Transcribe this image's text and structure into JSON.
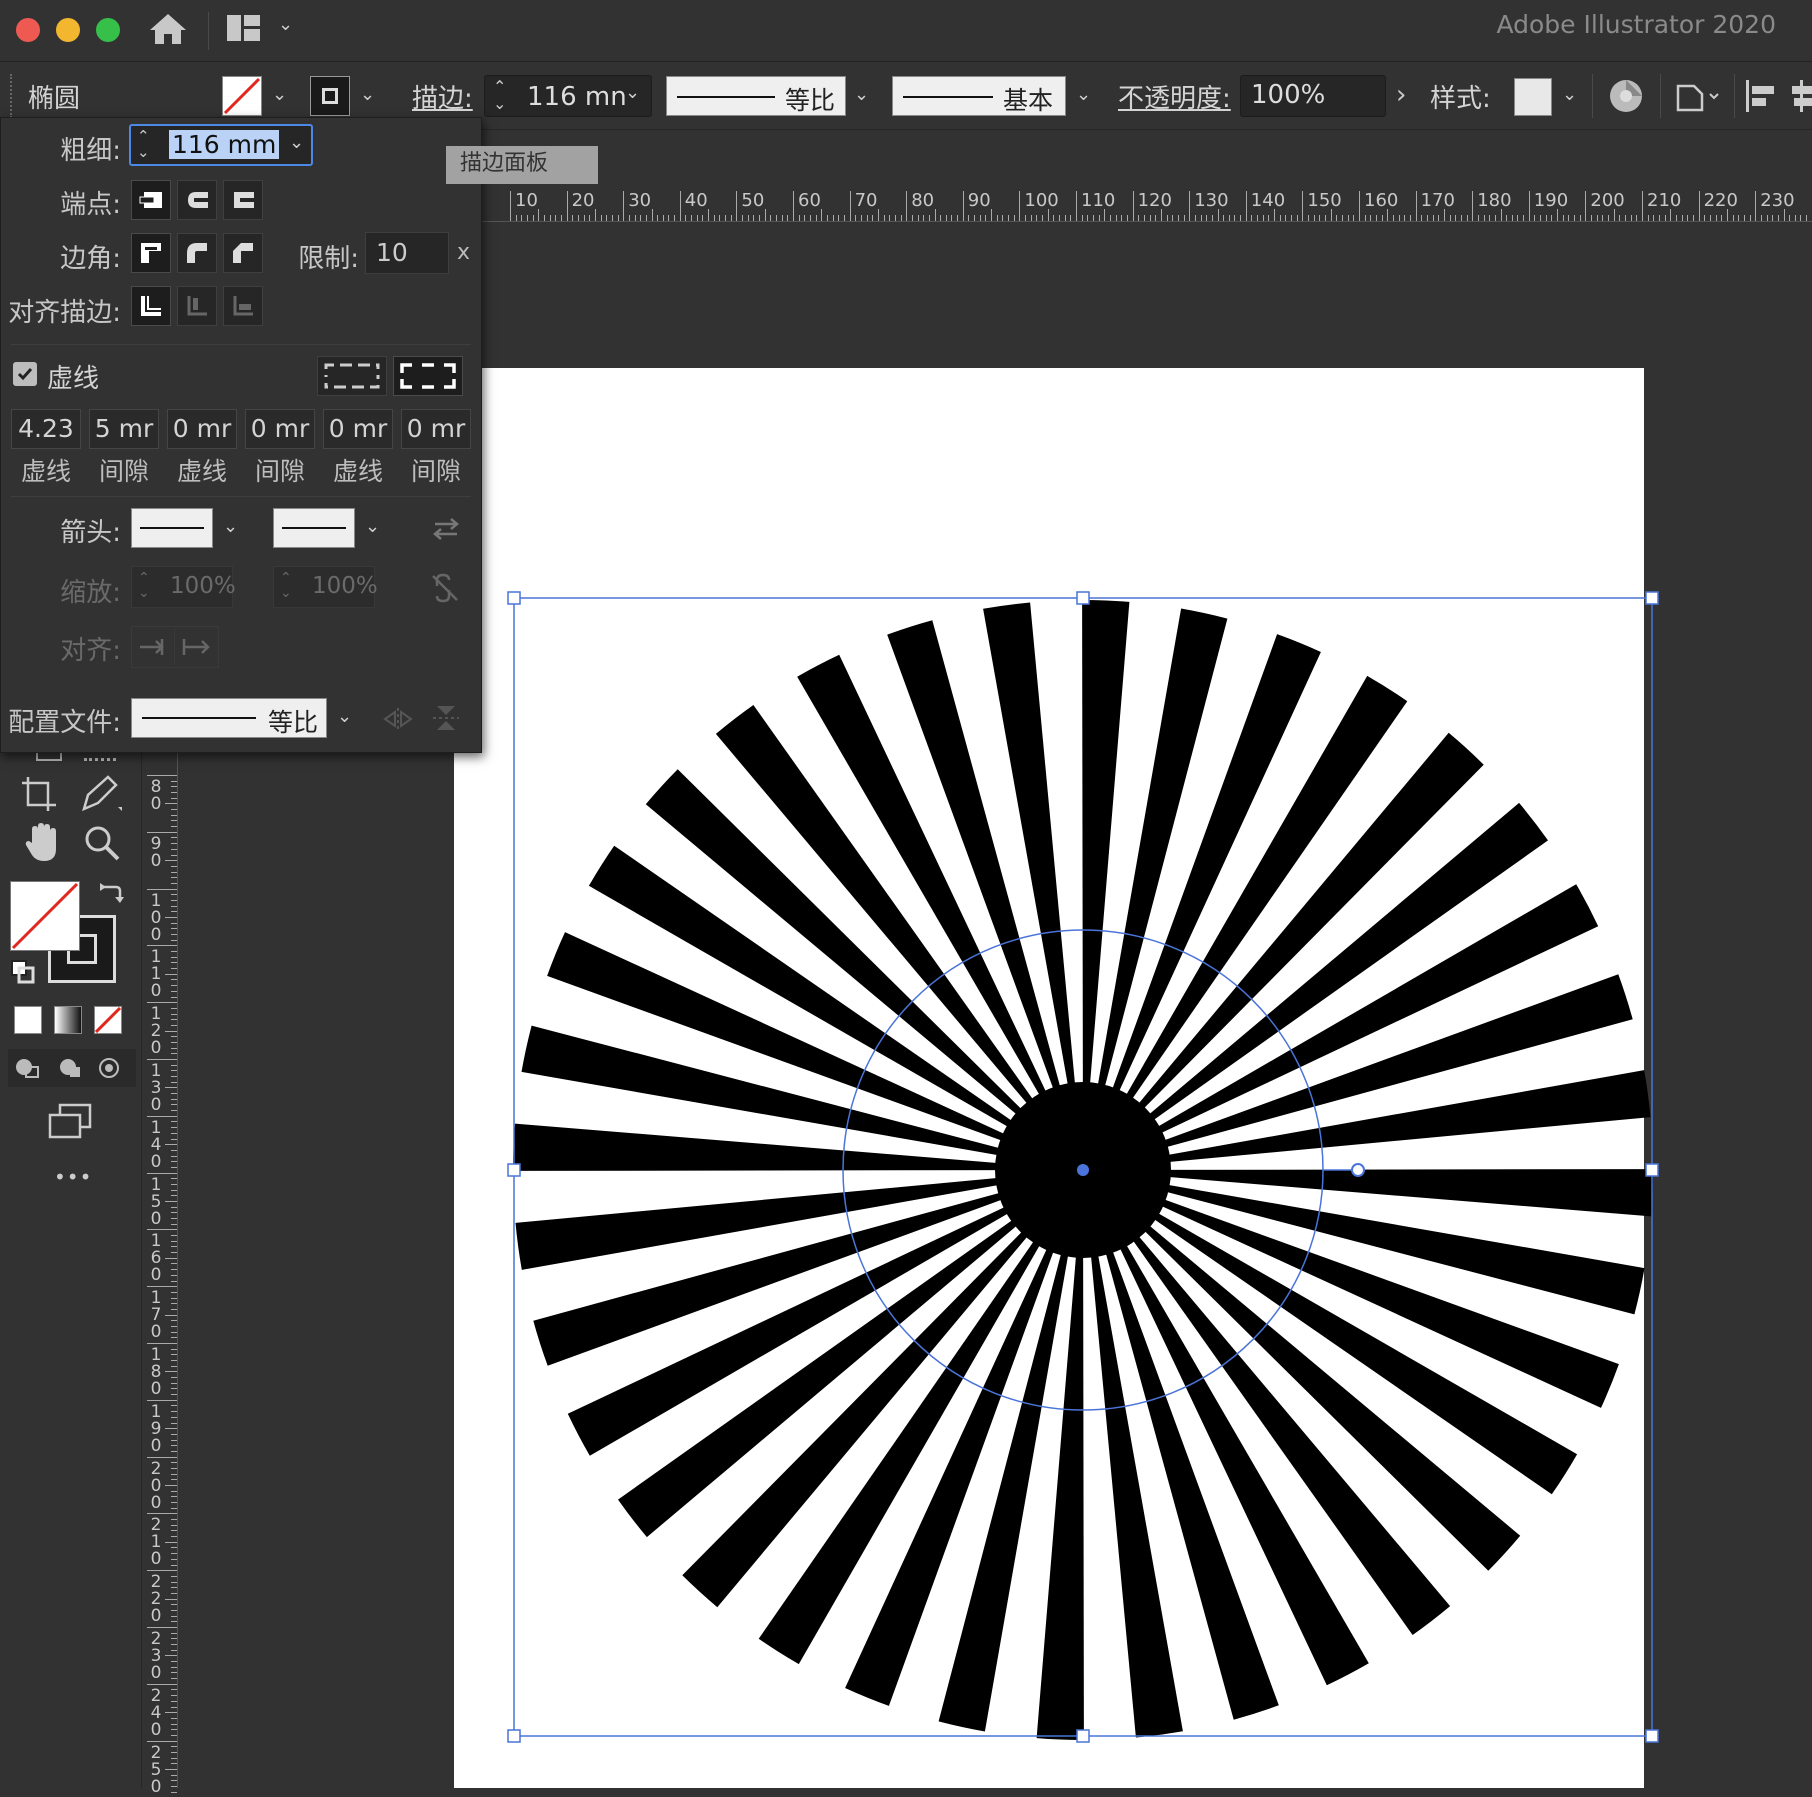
{
  "titlebar": {
    "app_title": "Adobe Illustrator 2020",
    "icons": [
      "close-dot",
      "minimize-dot",
      "zoom-dot",
      "home-icon",
      "workspace-layout-icon",
      "chevron-down-icon"
    ]
  },
  "control_bar": {
    "object_type": "椭圆",
    "stroke_label": "描边:",
    "stroke_weight": "116 mm",
    "stroke_weight_visible": "116 mn",
    "profile1_label": "等比",
    "profile2_label": "基本",
    "opacity_label": "不透明度:",
    "opacity_value": "100%",
    "style_label": "样式:"
  },
  "tooltip": {
    "text": "描边面板"
  },
  "stroke_panel": {
    "weight_label": "粗细:",
    "weight_value": "116 mm",
    "cap_label": "端点:",
    "corner_label": "边角:",
    "limit_label": "限制:",
    "limit_value": "10",
    "limit_unit": "x",
    "align_label": "对齐描边:",
    "dashed_label": "虚线",
    "dashed_checked": true,
    "dash_values": [
      "4.23",
      "5 mr",
      "0 mr",
      "0 mr",
      "0 mr",
      "0 mr"
    ],
    "dash_labels": [
      "虚线",
      "间隙",
      "虚线",
      "间隙",
      "虚线",
      "间隙"
    ],
    "arrow_label": "箭头:",
    "scale_label": "缩放:",
    "scale_value_1": "100%",
    "scale_value_2": "100%",
    "arrow_align_label": "对齐:",
    "profile_label": "配置文件:",
    "profile_value": "等比"
  },
  "horizontal_ruler": [
    "10",
    "20",
    "30",
    "40",
    "50",
    "60",
    "70",
    "80",
    "90",
    "100",
    "110",
    "120",
    "130",
    "140",
    "150",
    "160",
    "170",
    "180",
    "190",
    "200",
    "210",
    "220",
    "230"
  ],
  "vertical_ruler": [
    "80",
    "90",
    "100",
    "110",
    "120",
    "130",
    "140",
    "150",
    "160",
    "170",
    "180",
    "190",
    "200",
    "210",
    "220",
    "230",
    "240",
    "250"
  ],
  "toolbar": {
    "tools": [
      "artboard-tool-icon",
      "pen-tool-icon",
      "hand-tool-icon",
      "zoom-tool-icon",
      "fill-stroke-swatch",
      "swap-fill-stroke-icon",
      "default-fill-stroke-icon",
      "color-mode-icon",
      "gradient-mode-icon",
      "none-mode-icon",
      "draw-normal-icon",
      "draw-behind-icon",
      "draw-inside-icon",
      "screen-mode-icon",
      "more-tools-icon"
    ],
    "more_label": "•••"
  },
  "artwork": {
    "description_shape": "ellipse",
    "spoke_count": 36,
    "spoke_color": "#000000",
    "selection_color": "#4a74d9"
  }
}
